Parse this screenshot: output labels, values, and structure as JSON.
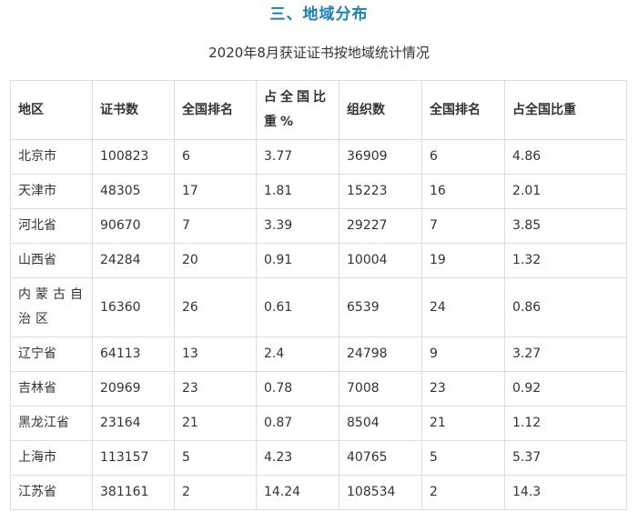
{
  "section_title": "三、地域分布",
  "caption": "2020年8月获证证书按地域统计情况",
  "table": {
    "headers": [
      "地区",
      "证书数",
      "全国排名",
      "占全国比重%",
      "组织数",
      "全国排名",
      "占全国比重"
    ],
    "rows": [
      [
        "北京市",
        "100823",
        "6",
        "3.77",
        "36909",
        "6",
        "4.86"
      ],
      [
        "天津市",
        "48305",
        "17",
        "1.81",
        "15223",
        "16",
        "2.01"
      ],
      [
        "河北省",
        "90670",
        "7",
        "3.39",
        "29227",
        "7",
        "3.85"
      ],
      [
        "山西省",
        "24284",
        "20",
        "0.91",
        "10004",
        "19",
        "1.32"
      ],
      [
        "内蒙古自治区",
        "16360",
        "26",
        "0.61",
        "6539",
        "24",
        "0.86"
      ],
      [
        "辽宁省",
        "64113",
        "13",
        "2.4",
        "24798",
        "9",
        "3.27"
      ],
      [
        "吉林省",
        "20969",
        "23",
        "0.78",
        "7008",
        "23",
        "0.92"
      ],
      [
        "黑龙江省",
        "23164",
        "21",
        "0.87",
        "8504",
        "21",
        "1.12"
      ],
      [
        "上海市",
        "113157",
        "5",
        "4.23",
        "40765",
        "5",
        "5.37"
      ],
      [
        "江苏省",
        "381161",
        "2",
        "14.24",
        "108534",
        "2",
        "14.3"
      ]
    ]
  }
}
